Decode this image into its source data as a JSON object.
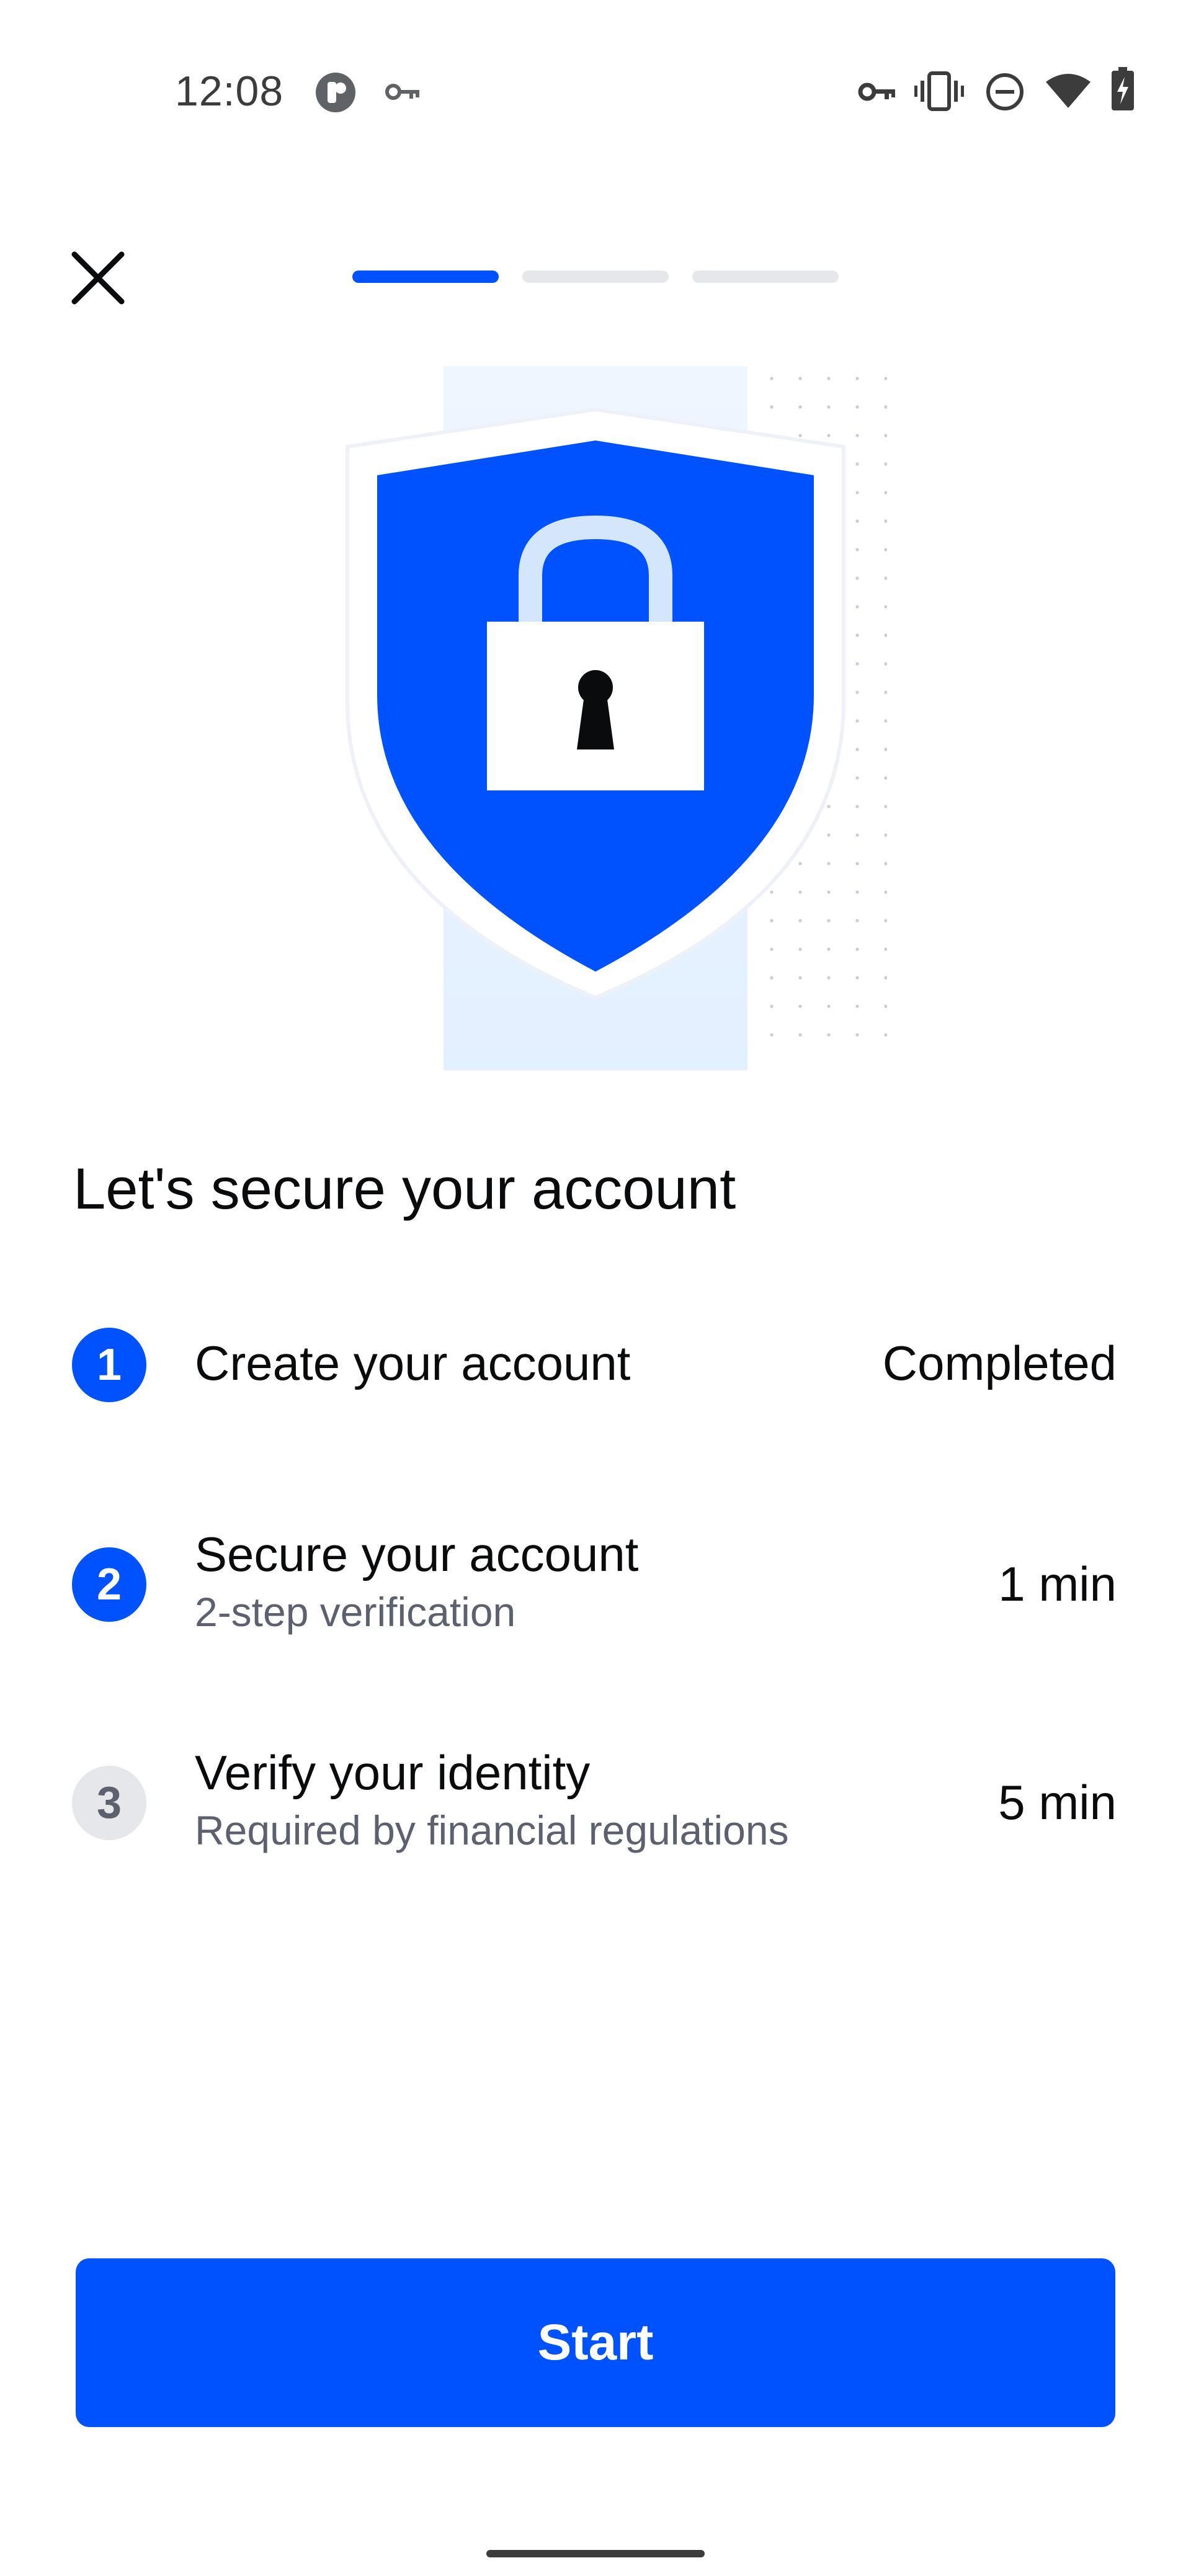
{
  "status_bar": {
    "time": "12:08",
    "left_icons": [
      "app-notification-icon",
      "vpn-key-icon"
    ],
    "right_icons": [
      "vpn-key-icon",
      "vibrate-icon",
      "do-not-disturb-icon",
      "wifi-icon",
      "battery-charging-icon"
    ]
  },
  "header": {
    "close_icon": "close-icon",
    "progress": {
      "total_steps": 3,
      "current_step": 1
    }
  },
  "hero": {
    "illustration": "shield-lock-icon"
  },
  "main": {
    "title": "Let's secure your account",
    "steps": [
      {
        "number": "1",
        "title": "Create your account",
        "subtitle": "",
        "status": "Completed",
        "state": "done"
      },
      {
        "number": "2",
        "title": "Secure your account",
        "subtitle": "2-step verification",
        "status": "1 min",
        "state": "current"
      },
      {
        "number": "3",
        "title": "Verify your identity",
        "subtitle": "Required by financial regulations",
        "status": "5 min",
        "state": "pending"
      }
    ]
  },
  "footer": {
    "start_label": "Start"
  },
  "colors": {
    "accent": "#0052ff",
    "inactive": "#e6e7ea",
    "muted_text": "#5b616e"
  }
}
